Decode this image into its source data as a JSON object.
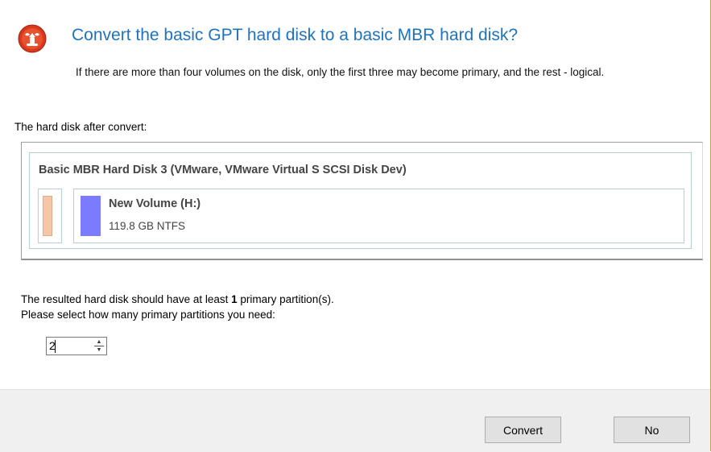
{
  "dialog": {
    "title": "Convert the basic GPT hard disk to a basic MBR hard disk?",
    "subtitle": "If there are more than four volumes on the disk, only the first three may become primary, and the rest - logical.",
    "after_label": "The hard disk after convert:",
    "icon": "app-logo-icon"
  },
  "disk": {
    "title": "Basic MBR Hard Disk 3 (VMware, VMware Virtual S SCSI Disk Dev)",
    "partitions": [
      {
        "name": "",
        "color": "#f7c6a6"
      },
      {
        "name": "New Volume (H:)",
        "info": "119.8 GB NTFS",
        "color": "#7b7bff"
      }
    ]
  },
  "result": {
    "line1_prefix": "The resulted hard disk should have at least ",
    "line1_count": "1",
    "line1_suffix": " primary partition(s).",
    "line2": "Please select how many primary partitions you need:"
  },
  "spinner": {
    "value": "2"
  },
  "buttons": {
    "convert": "Convert",
    "no": "No"
  },
  "colors": {
    "title": "#1e73be",
    "logo": "#d9381e"
  }
}
